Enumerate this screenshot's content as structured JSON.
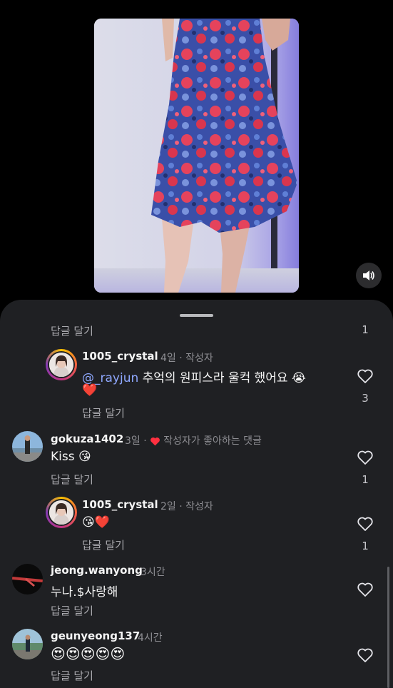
{
  "comments": [
    {
      "id": "top-reply-row",
      "reply_label": "답글 달기",
      "like_count": "1"
    },
    {
      "id": "c1",
      "username": "1005_crystal",
      "time": "4일",
      "author_tag": "작성자",
      "mention": "@_rayjun",
      "text": "추억의 원피스라 울컥 했어요 😭",
      "text_line2": "❤️",
      "reply_label": "답글 달기",
      "like_count": "3"
    },
    {
      "id": "c2",
      "username": "gokuza1402",
      "time": "3일",
      "liked_by_author": "작성자가 좋아하는 댓글",
      "text": "Kiss 😘",
      "reply_label": "답글 달기",
      "like_count": "1"
    },
    {
      "id": "c3",
      "username": "1005_crystal",
      "time": "2일",
      "author_tag": "작성자",
      "text": "😘❤️",
      "reply_label": "답글 달기",
      "like_count": "1"
    },
    {
      "id": "c4",
      "username": "jeong.wanyong",
      "time": "3시간",
      "text": "누나.$사랑해",
      "reply_label": "답글 달기"
    },
    {
      "id": "c5",
      "username": "geunyeong137",
      "time": "4시간",
      "text": "😍😍😍😍😍",
      "reply_label": "답글 달기"
    }
  ],
  "separator": "·",
  "icons": {
    "sound": "speaker-icon",
    "like": "heart-outline-icon",
    "author_like": "red-heart-icon"
  },
  "colors": {
    "sheet_bg": "#1f2023",
    "mention": "#8fa8ff",
    "author_heart": "#ff3040"
  }
}
